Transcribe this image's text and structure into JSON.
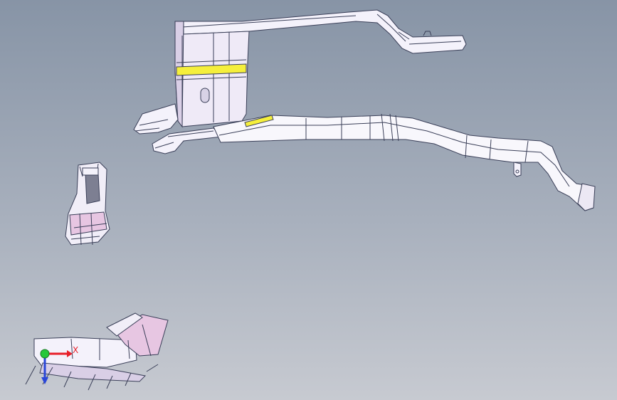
{
  "viewport": {
    "background_top": "#8794a6",
    "background_bottom": "#c7cad1"
  },
  "colors": {
    "part_body": "#f4f2fb",
    "part_shadow": "#d9cfe6",
    "part_pink": "#e7c6e2",
    "edge": "#3a3f58",
    "highlight_band": "#f5ef3c",
    "axis_x": "#e8202a",
    "axis_y": "#28c83a",
    "axis_z": "#2a46d8"
  },
  "triad": {
    "x_label": "X",
    "icon": "coordinate-triad-icon"
  }
}
